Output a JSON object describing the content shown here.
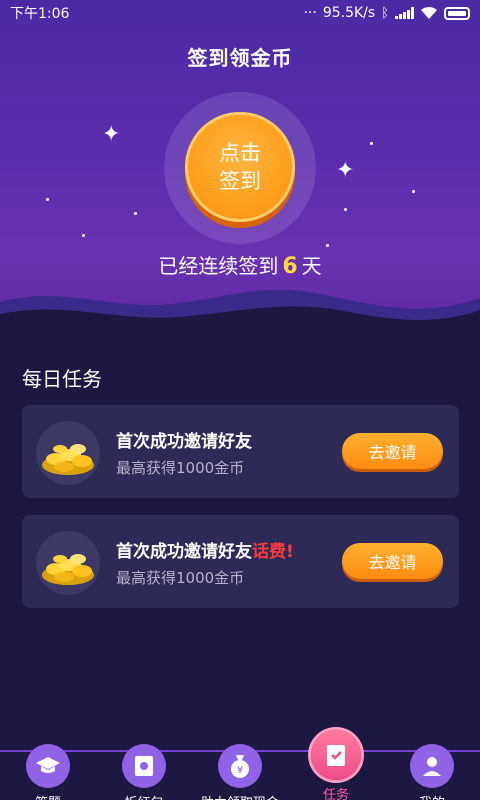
{
  "status_bar": {
    "time": "下午1:06",
    "dots": "···",
    "network_speed": "95.5K/s",
    "icons": [
      "bluetooth-icon",
      "signal-icon",
      "wifi-icon",
      "battery-icon"
    ]
  },
  "header": {
    "title": "签到领金币"
  },
  "sign_in": {
    "button_line1": "点击",
    "button_line2": "签到",
    "streak_prefix": "已经连续签到",
    "streak_days": "6",
    "streak_suffix": "天"
  },
  "tasks": {
    "section_title": "每日任务",
    "items": [
      {
        "title": "首次成功邀请好友",
        "highlight": "",
        "subtitle": "最高获得1000金币",
        "button": "去邀请",
        "icon": "gold-coins-icon"
      },
      {
        "title": "首次成功邀请好友",
        "highlight": "话费!",
        "subtitle": "最高获得1000金币",
        "button": "去邀请",
        "icon": "gold-coins-icon"
      }
    ]
  },
  "bottom_nav": {
    "items": [
      {
        "label": "答题",
        "icon": "graduation-cap-icon"
      },
      {
        "label": "拆红包",
        "icon": "red-envelope-icon"
      },
      {
        "label": "助力领取现金",
        "icon": "money-bag-icon"
      },
      {
        "label": "任务",
        "icon": "task-clipboard-icon",
        "active": true
      },
      {
        "label": "我的",
        "icon": "user-icon"
      }
    ]
  },
  "colors": {
    "hero_top": "#4b2aa5",
    "background": "#1c1842",
    "card": "#2d2a57",
    "accent_orange": "#ff9e1c",
    "streak_yellow": "#ffd83a",
    "highlight_red": "#ff3b3b",
    "nav_active": "#f04c8a"
  }
}
